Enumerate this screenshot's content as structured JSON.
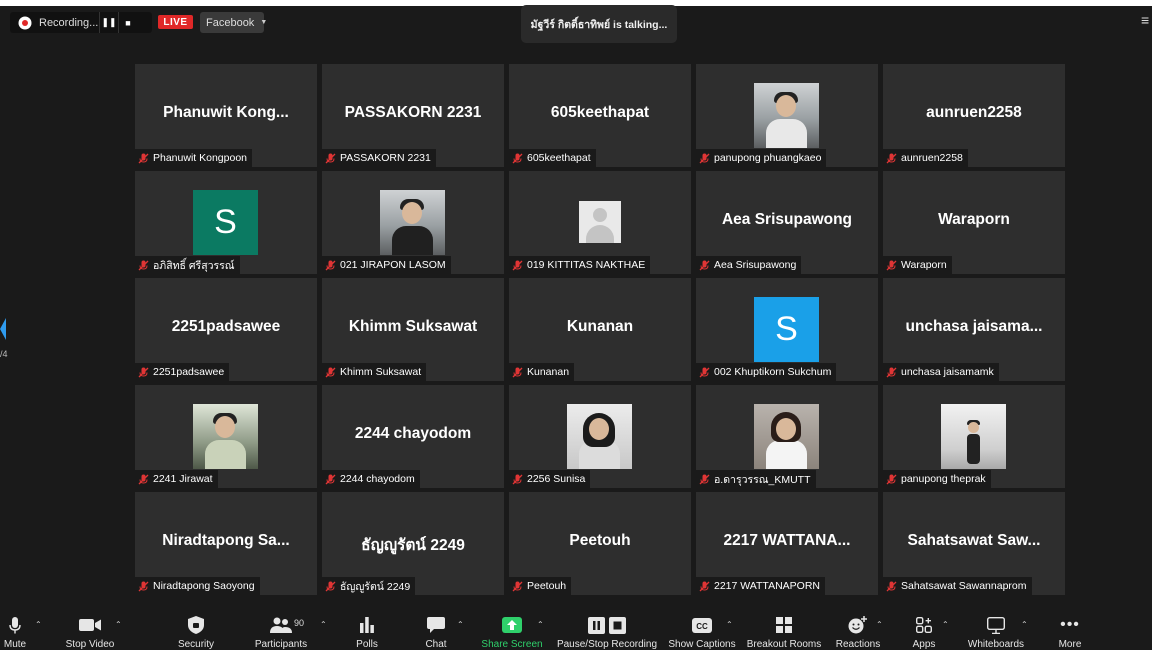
{
  "status_bar": {
    "recording_text": "Recording...",
    "live_label": "LIVE",
    "platform_label": "Facebook",
    "talking_text": "มัฐวีร์ กิตติ์ธาทิพย์ is talking..."
  },
  "colors": {
    "live": "#e02828",
    "share_screen": "#2fd06b",
    "avatar_teal": "#0b7a62",
    "avatar_blue": "#1aa0e8",
    "mute_slash": "#e03535"
  },
  "pagination": {
    "text": "/4"
  },
  "participants": [
    {
      "display": "Phanuwit  Kong...",
      "label": "Phanuwit Kongpoon",
      "media": "name"
    },
    {
      "display": "PASSAKORN 2231",
      "label": "PASSAKORN 2231",
      "media": "name"
    },
    {
      "display": "605keethapat",
      "label": "605keethapat",
      "media": "name"
    },
    {
      "display": "",
      "label": "panupong phuangkaeo",
      "media": "photo"
    },
    {
      "display": "aunruen2258",
      "label": "aunruen2258",
      "media": "name"
    },
    {
      "display": "S",
      "label": "อภิสิทธิ์ ศรีสุวรรณ์",
      "media": "avatar-teal"
    },
    {
      "display": "",
      "label": "021 JIRAPON LASOM",
      "media": "photo"
    },
    {
      "display": "",
      "label": "019 KITTITAS NAKTHAE",
      "media": "placeholder"
    },
    {
      "display": "Aea Srisupawong",
      "label": "Aea Srisupawong",
      "media": "name"
    },
    {
      "display": "Waraporn",
      "label": "Waraporn",
      "media": "name"
    },
    {
      "display": "2251padsawee",
      "label": "2251padsawee",
      "media": "name"
    },
    {
      "display": "Khimm Suksawat",
      "label": "Khimm Suksawat",
      "media": "name"
    },
    {
      "display": "Kunanan",
      "label": "Kunanan",
      "media": "name"
    },
    {
      "display": "S",
      "label": "002 Khuptikorn Sukchum",
      "media": "avatar-blue"
    },
    {
      "display": "unchasa  jaisama...",
      "label": "unchasa jaisamamk",
      "media": "name"
    },
    {
      "display": "",
      "label": "2241 Jirawat",
      "media": "photo"
    },
    {
      "display": "2244 chayodom",
      "label": "2244 chayodom",
      "media": "name"
    },
    {
      "display": "",
      "label": "2256 Sunisa",
      "media": "photo"
    },
    {
      "display": "",
      "label": "อ.ดารุวรรณ_KMUTT",
      "media": "photo"
    },
    {
      "display": "",
      "label": "panupong theprak",
      "media": "photo"
    },
    {
      "display": "Niradtapong  Sa...",
      "label": "Niradtapong Saoyong",
      "media": "name"
    },
    {
      "display": "ธัญญูรัตน์ 2249",
      "label": "ธัญญูรัตน์ 2249",
      "media": "name"
    },
    {
      "display": "Peetouh",
      "label": "Peetouh",
      "media": "name"
    },
    {
      "display": "2217  WATTANA...",
      "label": "2217 WATTANAPORN",
      "media": "name"
    },
    {
      "display": "Sahatsawat  Saw...",
      "label": "Sahatsawat Sawannaprom",
      "media": "name"
    }
  ],
  "toolbar": {
    "mute": "Mute",
    "stop_video": "Stop Video",
    "security": "Security",
    "participants": "Participants",
    "participants_count": "90",
    "polls": "Polls",
    "chat": "Chat",
    "share_screen": "Share Screen",
    "pause_stop_recording": "Pause/Stop Recording",
    "show_captions": "Show Captions",
    "breakout_rooms": "Breakout Rooms",
    "reactions": "Reactions",
    "apps": "Apps",
    "whiteboards": "Whiteboards",
    "more": "More"
  }
}
